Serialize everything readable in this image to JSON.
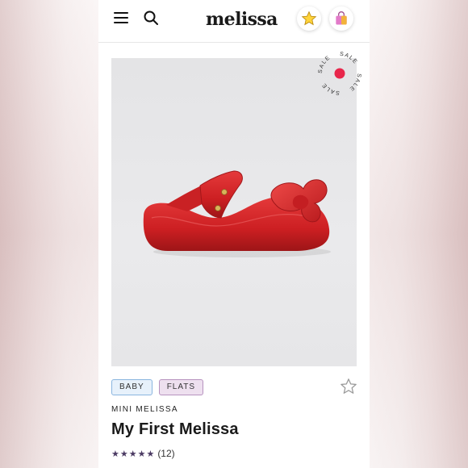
{
  "header": {
    "logo": "melissa",
    "menu_icon": "hamburger-menu-icon",
    "search_icon": "search-icon",
    "wishlist_icon": "star-icon",
    "bag_icon": "shopping-bag-icon"
  },
  "product": {
    "sale_badge": "SALE",
    "tags": [
      "BABY",
      "FLATS"
    ],
    "brand": "MINI MELISSA",
    "name": "My First Melissa",
    "rating_stars": "★★★★★",
    "rating_value": 5,
    "review_count": "(12)"
  },
  "colors": {
    "sale_dot": "#e8264b",
    "shoe": "#d8262a",
    "rating_star": "#4b3a63",
    "tag_baby_border": "#8ab5df",
    "tag_flats_border": "#b793bf"
  }
}
